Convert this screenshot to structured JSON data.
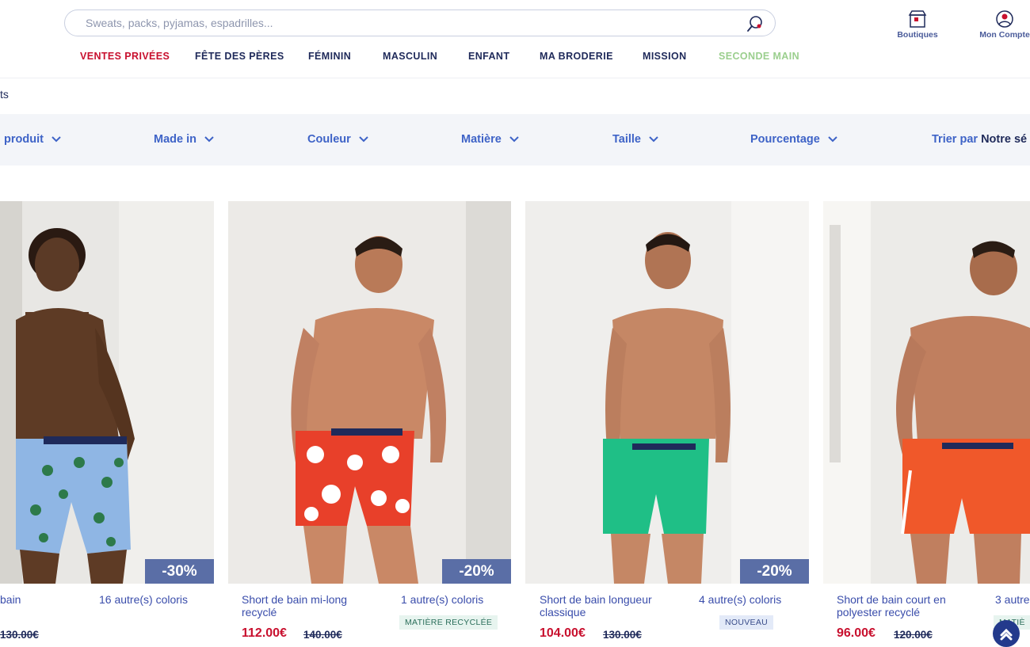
{
  "search": {
    "placeholder": "Sweats, packs, pyjamas, espadrilles..."
  },
  "nav": [
    {
      "label": "VENTES PRIVÉES",
      "color": "#c8102e"
    },
    {
      "label": "FÊTE DES PÈRES",
      "color": "#1f2a5a"
    },
    {
      "label": "FÉMININ",
      "color": "#1f2a5a"
    },
    {
      "label": "MASCULIN",
      "color": "#1f2a5a"
    },
    {
      "label": "ENFANT",
      "color": "#1f2a5a"
    },
    {
      "label": "MA BRODERIE",
      "color": "#1f2a5a"
    },
    {
      "label": "MISSION",
      "color": "#1f2a5a"
    },
    {
      "label": "SECONDE MAIN",
      "color": "#9bcf8e"
    }
  ],
  "header_icons": {
    "shops_label": "Boutiques",
    "account_label": "Mon Compte"
  },
  "breadcrumb": "ts",
  "filters": [
    "produit",
    "Made in",
    "Couleur",
    "Matière",
    "Taille",
    "Pourcentage"
  ],
  "sort": {
    "label": "Trier par",
    "value": "Notre sé"
  },
  "products": [
    {
      "name": "bain",
      "colors": "16 autre(s) coloris",
      "tag": "",
      "price": "",
      "old_price": "130.00€",
      "discount": "-30%",
      "short_color": "#8fb6e4",
      "pattern": "stars"
    },
    {
      "name": "Short de bain mi-long recyclé",
      "colors": "1 autre(s) coloris",
      "tag": "MATIÈRE RECYCLÉE",
      "price": "112.00€",
      "old_price": "140.00€",
      "discount": "-20%",
      "short_color": "#e8402a",
      "pattern": "floral"
    },
    {
      "name": "Short de bain longueur classique",
      "colors": "4 autre(s) coloris",
      "tag": "NOUVEAU",
      "price": "104.00€",
      "old_price": "130.00€",
      "discount": "-20%",
      "short_color": "#1fbf86",
      "pattern": "plain"
    },
    {
      "name": "Short de bain court en polyester recyclé",
      "colors": "3 autre",
      "tag": "MATIÈ",
      "price": "96.00€",
      "old_price": "120.00€",
      "discount": "",
      "short_color": "#f0582a",
      "pattern": "plain"
    }
  ]
}
